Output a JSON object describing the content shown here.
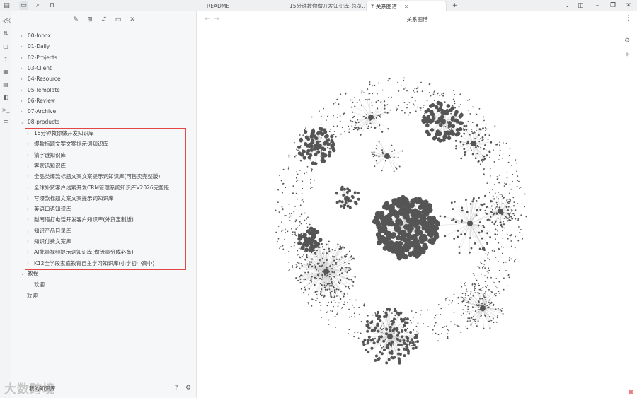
{
  "titlebar": {
    "tabs": [
      {
        "label": "README",
        "active": false
      },
      {
        "label": "15分钟教你做开发知识库-总览...",
        "active": false
      },
      {
        "label": "关系图谱",
        "active": true
      }
    ],
    "new_tab": "+",
    "dropdown": "⌄",
    "close": "✕"
  },
  "explorer": {
    "folders": [
      {
        "label": "00-Inbox"
      },
      {
        "label": "01-Daily"
      },
      {
        "label": "02-Projects"
      },
      {
        "label": "03-Client"
      },
      {
        "label": "04-Resource"
      },
      {
        "label": "05-Template"
      },
      {
        "label": "06-Review"
      },
      {
        "label": "07-Archive"
      },
      {
        "label": "08-products",
        "expanded": true
      }
    ],
    "products": [
      "15分钟教你做开发知识库",
      "爆款标题文案文案提示词知识库",
      "猜字谜知识库",
      "客家话知识库",
      "全品类爆款标题文案文案提示词知识库(可售卖完整版)",
      "全球外贸客户线索开发CRM管理系统知识库V2026完整版",
      "写爆款标题文案文案提示词知识库",
      "英语口语知识库",
      "越南语打电话开发客户知识库(外贸定制版)",
      "知识产品目录库",
      "知识付费文案库",
      "AI批量视频提示词知识库(做流量分成必备)",
      "K12全学段家庭教育自主学习知识库(小学初中高中)"
    ],
    "other": {
      "folder": "教程",
      "child": "欢迎",
      "root_note": "欢迎"
    },
    "vault_name": "我的知识库",
    "watermark": "大数跨境"
  },
  "graph": {
    "title": "关系图谱",
    "node_color": "#555555",
    "edge_color": "#cfcfcf"
  }
}
